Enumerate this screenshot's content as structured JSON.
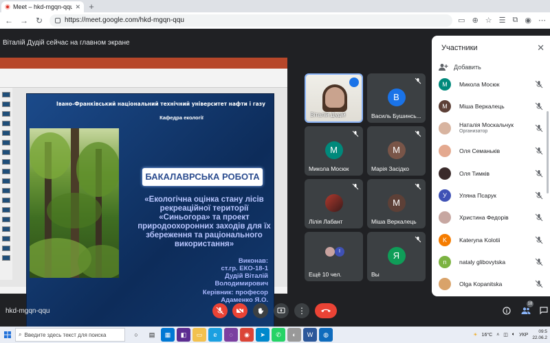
{
  "browser": {
    "tab_title": "Meet – hkd-mgqn-qqu",
    "tab_close": "✕",
    "new_tab": "+",
    "url": "https://meet.google.com/hkd-mgqn-qqu"
  },
  "presenting": {
    "banner": "Віталій Дудій сейчас на главном экране"
  },
  "slide": {
    "university": "Івано-Франківський національний технічний університет нафти і газу",
    "department": "Кафедра екології",
    "banner": "БАКАЛАВРСЬКА РОБОТА",
    "thesis": "«Екологічна оцінка стану лісів рекреаційної території «Синьогора» та проект природоохоронних заходів для їх збереження та раціонального використання»",
    "author_lines": [
      "Виконав:",
      "ст.гр. ЕКО-18-1",
      "Дудій Віталій",
      "Володимирович"
    ],
    "supervisor_lines": [
      "Керівник: професор",
      "Адаменко Я.О."
    ]
  },
  "tiles": [
    {
      "name": "Віталій Дудій",
      "type": "video",
      "speaking": true
    },
    {
      "name": "Василь Бушинсь...",
      "letter": "В",
      "color": "#1a73e8",
      "muted": true
    },
    {
      "name": "Микола Мосюк",
      "letter": "М",
      "color": "#00897b",
      "muted": true
    },
    {
      "name": "Марія Засідко",
      "letter": "М",
      "color": "#795548",
      "muted": true
    },
    {
      "name": "Лілія Лабант",
      "type": "photo",
      "muted": true
    },
    {
      "name": "Міша Веркалець",
      "letter": "М",
      "color": "#5d4037",
      "muted": true
    },
    {
      "name": "Ещё 10 чел.",
      "type": "more",
      "muted": false
    },
    {
      "name": "Вы",
      "letter": "Я",
      "color": "#0f9d58",
      "muted": true
    }
  ],
  "people": {
    "title": "Участники",
    "add_label": "Добавить",
    "list": [
      {
        "name": "Микола Мосюк",
        "letter": "М",
        "color": "#00897b"
      },
      {
        "name": "Міша Веркалець",
        "letter": "М",
        "color": "#5d4037"
      },
      {
        "name": "Наталія Москальчук",
        "sub": "Организатор",
        "letter": "",
        "color": "#d8b4a0"
      },
      {
        "name": "Оля Семаньків",
        "letter": "",
        "color": "#e4a98f"
      },
      {
        "name": "Оля Тимків",
        "letter": "",
        "color": "#3a2a2a"
      },
      {
        "name": "Уляна Псарук",
        "letter": "У",
        "color": "#3f51b5"
      },
      {
        "name": "Христина Федорів",
        "letter": "",
        "color": "#c7a7a1"
      },
      {
        "name": "Kateryna Kolotii",
        "letter": "K",
        "color": "#f57c00"
      },
      {
        "name": "nataly glibovytska",
        "letter": "n",
        "color": "#7cb342"
      },
      {
        "name": "Olga Kopanitska",
        "letter": "",
        "color": "#d9a36a"
      }
    ]
  },
  "meeting_bar": {
    "code": "hkd-mgqn-qqu",
    "people_count": "18"
  },
  "taskbar": {
    "search_placeholder": "Введите здесь текст для поиска",
    "weather": "16°C",
    "lang": "УКР",
    "time": "09:5",
    "date": "22.06.2"
  }
}
